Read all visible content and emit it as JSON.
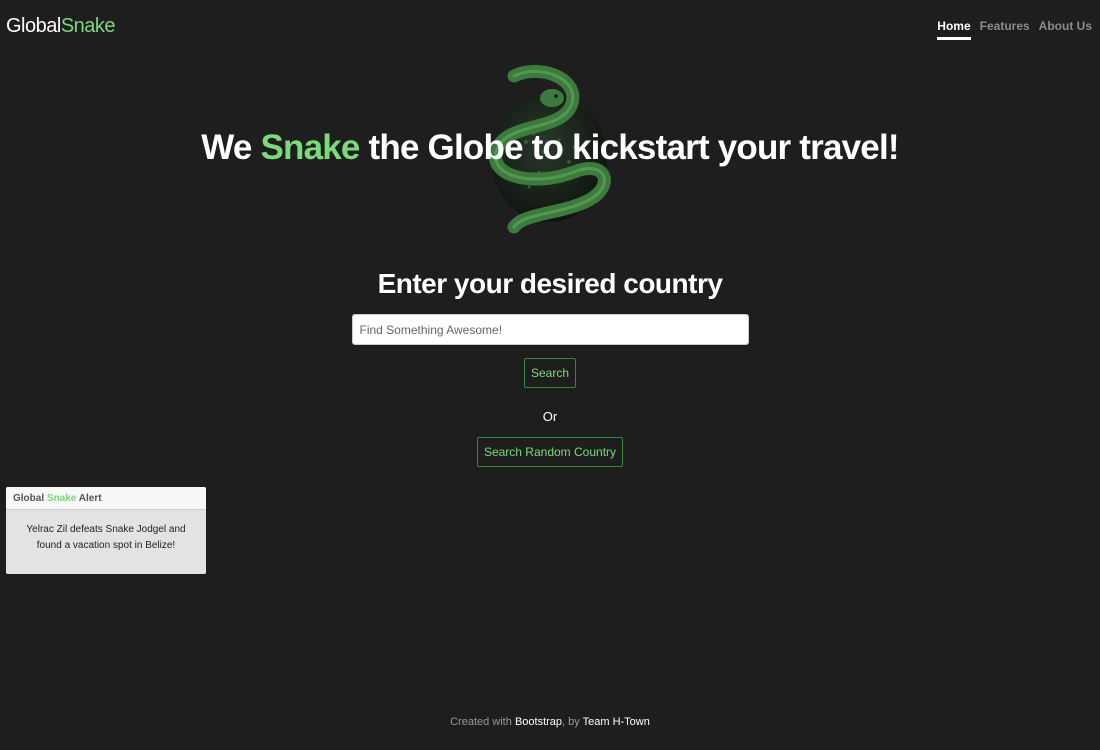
{
  "navbar": {
    "brand_prefix": "Global",
    "brand_accent": "Snake",
    "links": [
      {
        "label": "Home",
        "active": true
      },
      {
        "label": "Features",
        "active": false
      },
      {
        "label": "About Us",
        "active": false
      }
    ]
  },
  "hero": {
    "title_prefix": "We",
    "title_accent": "Snake",
    "title_suffix": "the Globe to kickstart your travel!",
    "graphic_icon": "snake-globe-icon"
  },
  "search": {
    "heading": "Enter your desired country",
    "placeholder": "Find Something Awesome!",
    "value": "",
    "search_button": "Search",
    "or_label": "Or",
    "random_button": "Search Random Country"
  },
  "alert": {
    "title_prefix": "Global",
    "title_accent": "Snake",
    "title_suffix": "Alert",
    "message": "Yelrac Zil defeats Snake Jodgel and found a vacation spot in Belize!"
  },
  "footer": {
    "prefix": "Created with",
    "link1": "Bootstrap",
    "middle": ", by",
    "link2": "Team H-Town"
  },
  "colors": {
    "background": "#1e1e1e",
    "accent": "#7ad97a",
    "button_border": "#2f8a3d"
  }
}
